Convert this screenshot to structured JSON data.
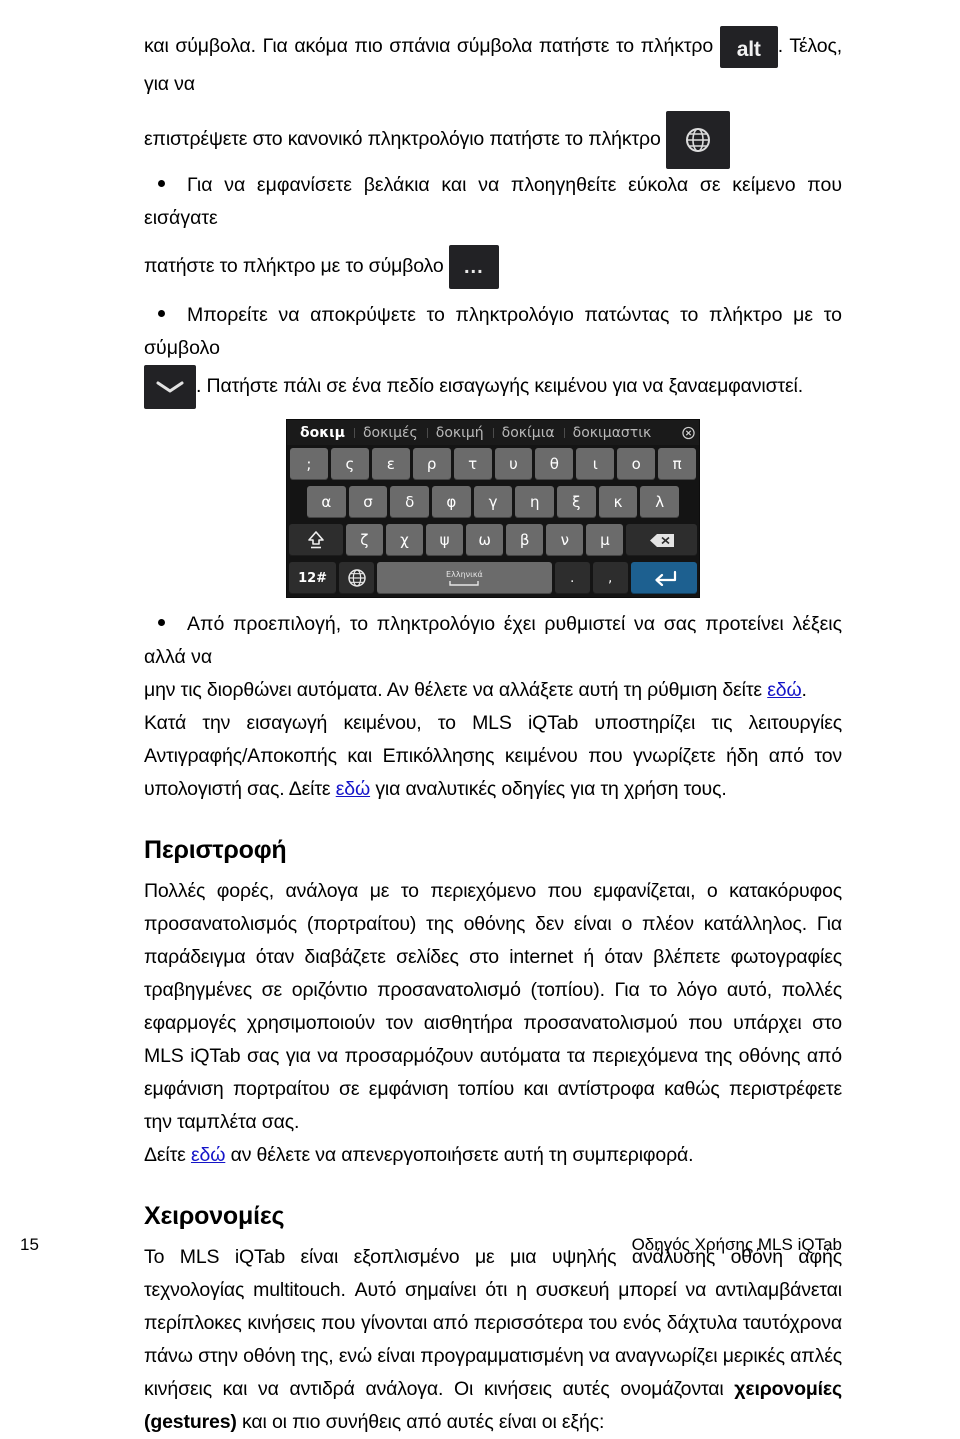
{
  "document": {
    "title": "Οδηγός Χρήσης MLS iQTab",
    "page_number": "15"
  },
  "body": {
    "p1_before_key": "και σύμβολα. Για ακόμα πιο σπάνια σύμβολα πατήστε το πλήκτρο ",
    "key_alt_label": "alt",
    "p1_after_key": ". Τέλος, για να",
    "p2_before_key": "επιστρέψετε στο κανονικό πληκτρολόγιο πατήστε το  πλήκτρο ",
    "key_globe_name": "globe-icon",
    "bullet1": "Για να εμφανίσετε βελάκια και να πλοηγηθείτε εύκολα σε κείμενο που εισάγατε",
    "bullet1_cont": "πατήστε το πλήκτρο με το σύμβολο ",
    "key_dots_label": "...",
    "bullet2": "Μπορείτε να αποκρύψετε το πληκτρολόγιο πατώντας το πλήκτρο με το σύμβολο",
    "key_chevron_name": "chevron-down-icon",
    "bullet2_cont": ". Πατήστε πάλι σε ένα πεδίο εισαγωγής κειμένου για να ξαναεμφανιστεί.",
    "bullet3_line1": "Από προεπιλογή, το πληκτρολόγιο έχει ρυθμιστεί να σας προτείνει λέξεις αλλά να",
    "bullet3_line2_a": "μην τις διορθώνει αυτόματα. Αν θέλετε να αλλάξετε αυτή τη ρύθμιση δείτε ",
    "link_here": "εδώ",
    "bullet3_line2_b": ".",
    "p3_a": "Κατά την εισαγωγή κειμένου, το MLS iQTab υποστηρίζει τις λειτουργίες Αντιγραφής/Αποκοπής και Επικόλλησης κειμένου που γνωρίζετε ήδη από τον υπολογιστή σας. Δείτε ",
    "p3_b": " για αναλυτικές οδηγίες για τη χρήση τους.",
    "section_rotation_title": "Περιστροφή",
    "rotation_p1": "Πολλές φορές, ανάλογα με το περιεχόμενο που εμφανίζεται, ο κατακόρυφος προσανατολισμός (πορτραίτου) της οθόνης δεν είναι ο πλέον κατάλληλος. Για παράδειγμα όταν διαβάζετε σελίδες στο internet ή όταν βλέπετε φωτογραφίες τραβηγμένες σε οριζόντιο προσανατολισμό (τοπίου). Για το λόγο αυτό, πολλές εφαρμογές χρησιμοποιούν τον αισθητήρα προσανατολισμού που υπάρχει στο MLS iQTab σας για να προσαρμόζουν αυτόματα τα περιεχόμενα της οθόνης από εμφάνιση πορτραίτου σε εμφάνιση τοπίου και αντίστροφα καθώς περιστρέφετε την ταμπλέτα σας.",
    "rotation_p2_a": "Δείτε ",
    "rotation_p2_b": " αν θέλετε να απενεργοποιήσετε αυτή τη συμπεριφορά.",
    "section_gestures_title": "Χειρονομίες",
    "gestures_p_a": "Το MLS iQTab είναι εξοπλισμένο με μια υψηλής ανάλυσης οθόνη αφής τεχνολογίας multitouch. Αυτό σημαίνει ότι η συσκευή μπορεί να αντιλαμβάνεται περίπλοκες κινήσεις που γίνονται από περισσότερα του ενός δάχτυλα ταυτόχρονα πάνω στην οθόνη της, ενώ είναι προγραμματισμένη να αναγνωρίζει μερικές απλές κινήσεις και να αντιδρά ανάλογα. Οι κινήσεις αυτές ονομάζονται ",
    "gestures_bold": "χειρονομίες (gestures)",
    "gestures_p_b": " και οι πιο συνήθεις από αυτές είναι οι εξής:"
  },
  "keyboard": {
    "suggestions": [
      {
        "text": "δοκιμ",
        "active": true
      },
      {
        "text": "δοκιμές",
        "active": false
      },
      {
        "text": "δοκιμή",
        "active": false
      },
      {
        "text": "δοκίμια",
        "active": false
      },
      {
        "text": "δοκιμαστικ",
        "active": false
      }
    ],
    "row1": [
      ";",
      "ς",
      "ε",
      "ρ",
      "τ",
      "υ",
      "θ",
      "ι",
      "ο",
      "π"
    ],
    "row2": [
      "α",
      "σ",
      "δ",
      "φ",
      "γ",
      "η",
      "ξ",
      "κ",
      "λ"
    ],
    "row3_letters": [
      "ζ",
      "χ",
      "ψ",
      "ω",
      "β",
      "ν",
      "μ"
    ],
    "shift_name": "shift-key",
    "backspace_name": "backspace-key",
    "num_key": "12#",
    "globe_key_name": "globe-key",
    "space_label": "Ελληνικά",
    "period_key": ".",
    "comma_key": ",",
    "enter_key_name": "enter-key",
    "colors": {
      "background": "#141414",
      "key": "#6b6b6b",
      "key_dark": "#2d2d2d",
      "enter": "#1d6090",
      "text": "#ffffff",
      "suggestion_inactive": "#b9b9b9"
    }
  }
}
